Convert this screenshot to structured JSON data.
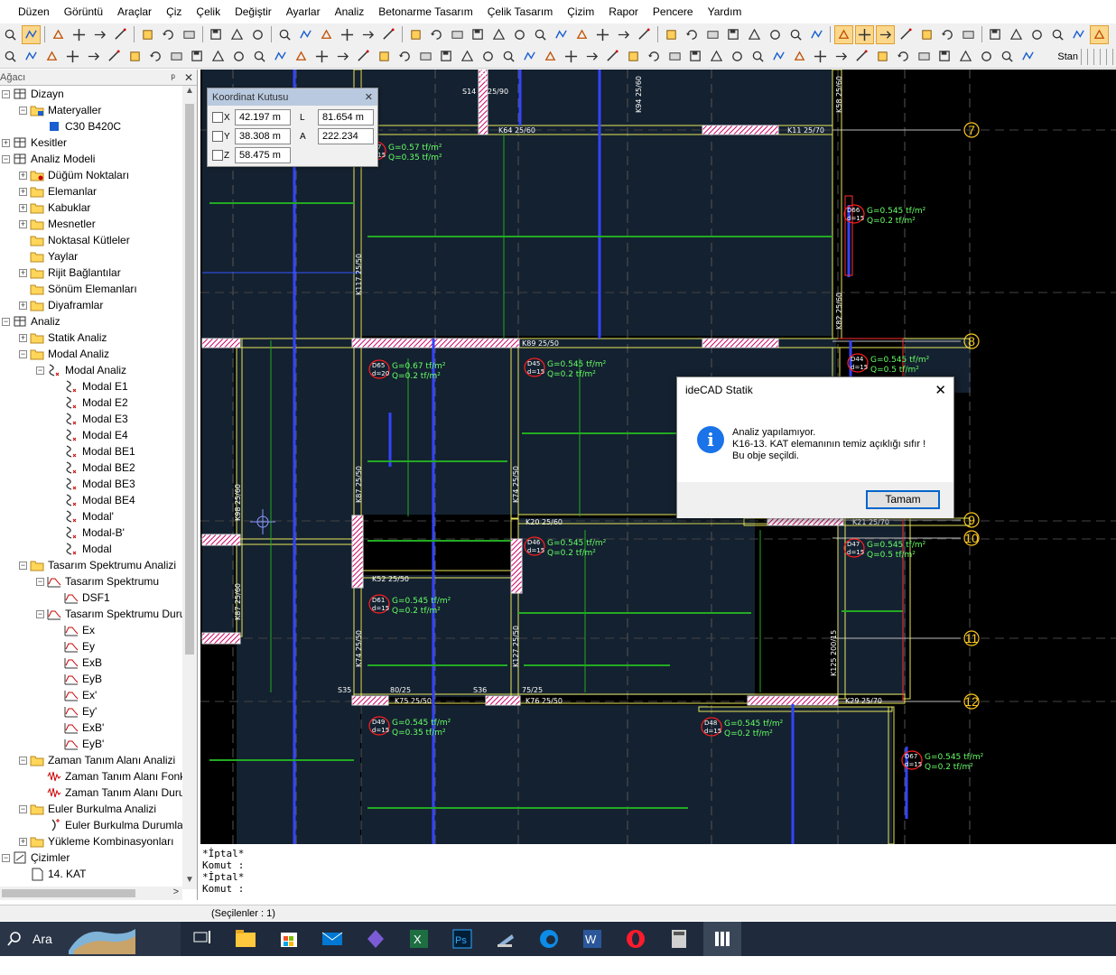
{
  "menu": [
    "Düzen",
    "Görüntü",
    "Araçlar",
    "Çiz",
    "Çelik",
    "Değiştir",
    "Ayarlar",
    "Analiz",
    "Betonarme Tasarım",
    "Çelik Tasarım",
    "Çizim",
    "Rapor",
    "Pencere",
    "Yardım"
  ],
  "toolbar": {
    "standard_label": "Stan"
  },
  "panel": {
    "title": "Ağacı",
    "pin": "ᵖ",
    "close": "✕"
  },
  "tree": [
    {
      "label": "Dizayn",
      "level": 0,
      "exp": "-",
      "icon": "structure"
    },
    {
      "label": "Materyaller",
      "level": 1,
      "exp": "-",
      "icon": "folder-blue"
    },
    {
      "label": "C30 B420C",
      "level": 2,
      "exp": "",
      "icon": "blue-square"
    },
    {
      "label": "Kesitler",
      "level": 0,
      "exp": "+",
      "icon": "sections"
    },
    {
      "label": "Analiz Modeli",
      "level": 0,
      "exp": "-",
      "icon": "structure"
    },
    {
      "label": "Düğüm Noktaları",
      "level": 1,
      "exp": "+",
      "icon": "folder-node"
    },
    {
      "label": "Elemanlar",
      "level": 1,
      "exp": "+",
      "icon": "folder"
    },
    {
      "label": "Kabuklar",
      "level": 1,
      "exp": "+",
      "icon": "folder"
    },
    {
      "label": "Mesnetler",
      "level": 1,
      "exp": "+",
      "icon": "folder-support"
    },
    {
      "label": "Noktasal Kütleler",
      "level": 1,
      "exp": "",
      "icon": "folder-mass"
    },
    {
      "label": "Yaylar",
      "level": 1,
      "exp": "",
      "icon": "folder-spring"
    },
    {
      "label": "Rijit Bağlantılar",
      "level": 1,
      "exp": "+",
      "icon": "folder"
    },
    {
      "label": "Sönüm Elemanları",
      "level": 1,
      "exp": "",
      "icon": "folder-damper"
    },
    {
      "label": "Diyaframlar",
      "level": 1,
      "exp": "+",
      "icon": "folder"
    },
    {
      "label": "Analiz",
      "level": 0,
      "exp": "-",
      "icon": "structure"
    },
    {
      "label": "Statik Analiz",
      "level": 1,
      "exp": "+",
      "icon": "folder-static"
    },
    {
      "label": "Modal Analiz",
      "level": 1,
      "exp": "-",
      "icon": "folder-modal"
    },
    {
      "label": "Modal Analiz",
      "level": 2,
      "exp": "-",
      "icon": "modal"
    },
    {
      "label": "Modal E1",
      "level": 3,
      "exp": "",
      "icon": "modal"
    },
    {
      "label": "Modal E2",
      "level": 3,
      "exp": "",
      "icon": "modal"
    },
    {
      "label": "Modal E3",
      "level": 3,
      "exp": "",
      "icon": "modal"
    },
    {
      "label": "Modal E4",
      "level": 3,
      "exp": "",
      "icon": "modal"
    },
    {
      "label": "Modal BE1",
      "level": 3,
      "exp": "",
      "icon": "modal"
    },
    {
      "label": "Modal BE2",
      "level": 3,
      "exp": "",
      "icon": "modal"
    },
    {
      "label": "Modal BE3",
      "level": 3,
      "exp": "",
      "icon": "modal"
    },
    {
      "label": "Modal BE4",
      "level": 3,
      "exp": "",
      "icon": "modal"
    },
    {
      "label": "Modal'",
      "level": 3,
      "exp": "",
      "icon": "modal"
    },
    {
      "label": "Modal-B'",
      "level": 3,
      "exp": "",
      "icon": "modal"
    },
    {
      "label": "Modal",
      "level": 3,
      "exp": "",
      "icon": "modal"
    },
    {
      "label": "Tasarım Spektrumu Analizi",
      "level": 1,
      "exp": "-",
      "icon": "folder-spectrum"
    },
    {
      "label": "Tasarım Spektrumu",
      "level": 2,
      "exp": "-",
      "icon": "spectrum"
    },
    {
      "label": "DSF1",
      "level": 3,
      "exp": "",
      "icon": "spectrum"
    },
    {
      "label": "Tasarım Spektrumu Duru",
      "level": 2,
      "exp": "-",
      "icon": "spectrum"
    },
    {
      "label": "Ex",
      "level": 3,
      "exp": "",
      "icon": "spectrum"
    },
    {
      "label": "Ey",
      "level": 3,
      "exp": "",
      "icon": "spectrum"
    },
    {
      "label": "ExB",
      "level": 3,
      "exp": "",
      "icon": "spectrum"
    },
    {
      "label": "EyB",
      "level": 3,
      "exp": "",
      "icon": "spectrum"
    },
    {
      "label": "Ex'",
      "level": 3,
      "exp": "",
      "icon": "spectrum"
    },
    {
      "label": "Ey'",
      "level": 3,
      "exp": "",
      "icon": "spectrum"
    },
    {
      "label": "ExB'",
      "level": 3,
      "exp": "",
      "icon": "spectrum"
    },
    {
      "label": "EyB'",
      "level": 3,
      "exp": "",
      "icon": "spectrum"
    },
    {
      "label": "Zaman Tanım Alanı Analizi",
      "level": 1,
      "exp": "-",
      "icon": "folder-time"
    },
    {
      "label": "Zaman Tanım Alanı Fonk",
      "level": 2,
      "exp": "",
      "icon": "time"
    },
    {
      "label": "Zaman Tanım Alanı Duru",
      "level": 2,
      "exp": "",
      "icon": "time"
    },
    {
      "label": "Euler Burkulma Analizi",
      "level": 1,
      "exp": "-",
      "icon": "folder-modal"
    },
    {
      "label": "Euler Burkulma Durumla",
      "level": 2,
      "exp": "",
      "icon": "euler"
    },
    {
      "label": "Yükleme Kombinasyonları",
      "level": 1,
      "exp": "+",
      "icon": "folder-combo"
    },
    {
      "label": "Çizimler",
      "level": 0,
      "exp": "-",
      "icon": "drawings"
    },
    {
      "label": "14. KAT",
      "level": 1,
      "exp": "",
      "icon": "page"
    }
  ],
  "coord_box": {
    "title": "Koordinat Kutusu",
    "x_label": "X",
    "x_value": "42.197 m",
    "y_label": "Y",
    "y_value": "38.308 m",
    "z_label": "Z",
    "z_value": "58.475 m",
    "l_label": "L",
    "l_value": "81.654 m",
    "a_label": "A",
    "a_value": "222.234"
  },
  "dialog": {
    "title": "ideCAD Statik",
    "line1": "Analiz yapılamıyor.",
    "line2": "K16-13. KAT elemanının temiz açıklığı sıfır !",
    "line3": "Bu obje seçildi.",
    "ok_label": "Tamam"
  },
  "command_lines": [
    "*İptal*",
    "Komut :",
    "*İptal*",
    "Komut :"
  ],
  "status_text": "(Seçilenler : 1)",
  "taskbar": {
    "search_label": "Ara"
  },
  "drawing": {
    "axis_labels": [
      "7",
      "8",
      "9",
      "10",
      "11",
      "12"
    ],
    "beam_labels": [
      "K64 25/60",
      "K11 25/70",
      "K89 25/50",
      "K20 25/60",
      "K21 25/70",
      "K52 25/50",
      "K75 25/50",
      "K76 25/50",
      "K29 25/70",
      "K117 25/50",
      "K87 25/50",
      "K74 25/50",
      "K74 25/50",
      "K127 25/50",
      "K98 25/60",
      "K87 25/60",
      "K94 25/60",
      "K58 25/60",
      "K82 25/60",
      "K125 200/15",
      "K95",
      "80/25",
      "75/25",
      "S14",
      "S35",
      "S36",
      "25/90"
    ],
    "slab_loads": [
      {
        "id": "D37",
        "d": "d=15",
        "g": "G=0.57 tf/m²",
        "q": "Q=0.35 tf/m²"
      },
      {
        "id": "D66",
        "d": "d=15",
        "g": "G=0.545 tf/m²",
        "q": "Q=0.2 tf/m²"
      },
      {
        "id": "D65",
        "d": "d=20",
        "g": "G=0.67 tf/m²",
        "q": "Q=0.2 tf/m²"
      },
      {
        "id": "D45",
        "d": "d=15",
        "g": "G=0.545 tf/m²",
        "q": "Q=0.2 tf/m²"
      },
      {
        "id": "D44",
        "d": "d=15",
        "g": "G=0.545 tf/m²",
        "q": "Q=0.5 tf/m²"
      },
      {
        "id": "D46",
        "d": "d=15",
        "g": "G=0.545 tf/m²",
        "q": "Q=0.2 tf/m²"
      },
      {
        "id": "D47",
        "d": "d=15",
        "g": "G=0.545 tf/m²",
        "q": "Q=0.5 tf/m²"
      },
      {
        "id": "D61",
        "d": "d=15",
        "g": "G=0.545 tf/m²",
        "q": "Q=0.2 tf/m²"
      },
      {
        "id": "D49",
        "d": "d=15",
        "g": "G=0.545 tf/m²",
        "q": "Q=0.35 tf/m²"
      },
      {
        "id": "D48",
        "d": "d=15",
        "g": "G=0.545 tf/m²",
        "q": "Q=0.2 tf/m²"
      },
      {
        "id": "D67",
        "d": "d=15",
        "g": "G=0.545 tf/m²",
        "q": "Q=0.2 tf/m²"
      }
    ]
  },
  "colors": {
    "canvas_bg": "#000000",
    "beam": "#e8e85a",
    "slab": "#142130",
    "axis_label": "#ffc820",
    "load_text": "#66ff66",
    "column_blue": "#3344ff"
  }
}
